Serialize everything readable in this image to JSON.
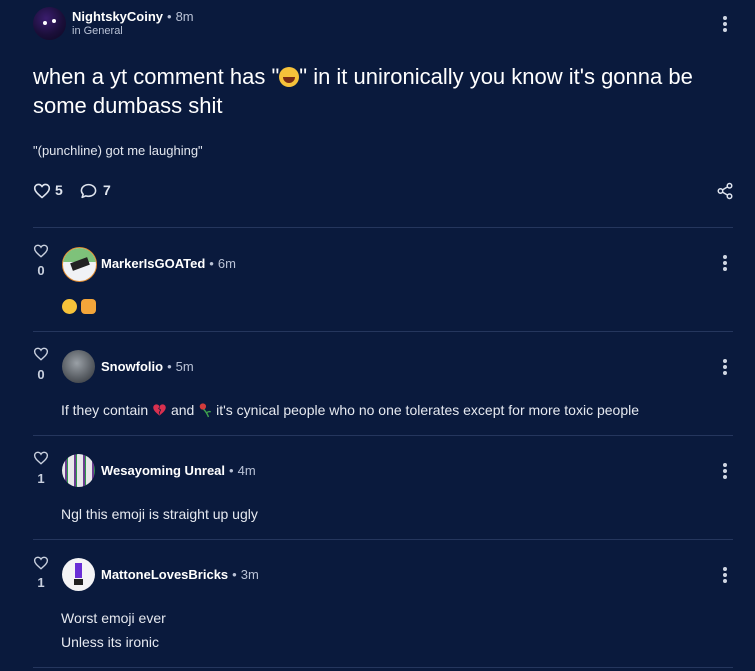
{
  "post": {
    "author": "NightskyCoiny",
    "time": "8m",
    "category": "in General",
    "title_part1": "when a yt comment has \"",
    "title_emoji": "😂",
    "title_part2": "\" in it unironically you know it's gonna be some dumbass shit",
    "subtitle": "\"(punchline) got me laughing\"",
    "likes": "5",
    "comments": "7"
  },
  "comments": [
    {
      "author": "MarkerIsGOATed",
      "time": "6m",
      "votes": "0",
      "text": ""
    },
    {
      "author": "Snowfolio",
      "time": "5m",
      "votes": "0",
      "text_part1": "If they contain",
      "text_part2": "and",
      "text_part3": "it's cynical people who no one tolerates except for more toxic people"
    },
    {
      "author": "Wesayoming Unreal",
      "time": "4m",
      "votes": "1",
      "text": "Ngl this emoji is straight up ugly"
    },
    {
      "author": "MattoneLovesBricks",
      "time": "3m",
      "votes": "1",
      "text_line1": "Worst emoji ever",
      "text_line2": "Unless its ironic"
    }
  ],
  "icons": {
    "heart": "heart-icon",
    "comment": "comment-icon",
    "share": "share-icon",
    "more": "more-options-icon"
  },
  "colors": {
    "background": "#0a1a3d",
    "divider": "#25365d",
    "muted_text": "#b9c2d6"
  }
}
